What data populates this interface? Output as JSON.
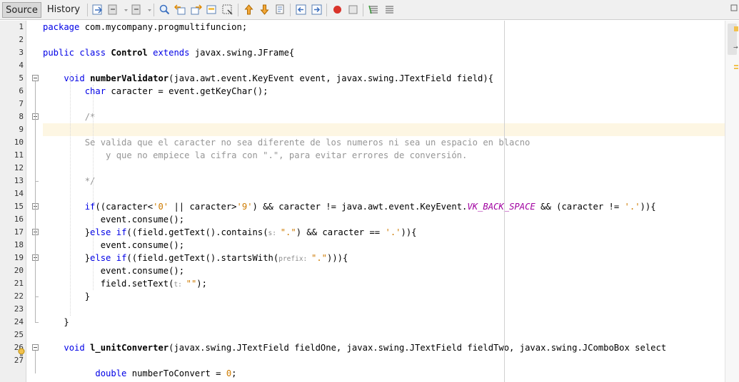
{
  "toolbar": {
    "tabs": {
      "source": "Source",
      "history": "History"
    }
  },
  "editor": {
    "line_numbers": [
      "1",
      "2",
      "3",
      "4",
      "5",
      "6",
      "7",
      "8",
      "9",
      "10",
      "11",
      "12",
      "13",
      "14",
      "15",
      "16",
      "17",
      "18",
      "19",
      "20",
      "21",
      "22",
      "23",
      "24",
      "25",
      "26",
      "27",
      ""
    ],
    "lines": [
      [
        {
          "t": "package",
          "c": "kw"
        },
        {
          "t": " com.mycompany.progmultifuncion;"
        }
      ],
      [],
      [
        {
          "t": "public class",
          "c": "kw"
        },
        {
          "t": " "
        },
        {
          "t": "Control",
          "c": "b"
        },
        {
          "t": " "
        },
        {
          "t": "extends",
          "c": "kw"
        },
        {
          "t": " javax.swing.JFrame{"
        }
      ],
      [],
      [
        {
          "t": "    "
        },
        {
          "t": "void",
          "c": "kw"
        },
        {
          "t": " "
        },
        {
          "t": "numberValidator",
          "c": "b"
        },
        {
          "t": "(java.awt.event.KeyEvent event, javax.swing.JTextField field){"
        }
      ],
      [
        {
          "t": "        "
        },
        {
          "t": "char",
          "c": "kw"
        },
        {
          "t": " caracter = event.getKeyChar();"
        }
      ],
      [],
      [
        {
          "t": "        /*",
          "c": "cm"
        }
      ],
      [],
      [
        {
          "t": "        Se valida que el caracter no sea diferente de los numeros ni sea un espacio en blacno",
          "c": "cm"
        }
      ],
      [
        {
          "t": "            y que no empiece la cifra con \".\", para evitar errores de conversión.",
          "c": "cm"
        }
      ],
      [],
      [
        {
          "t": "        */",
          "c": "cm"
        }
      ],
      [],
      [
        {
          "t": "        "
        },
        {
          "t": "if",
          "c": "kw"
        },
        {
          "t": "((caracter<"
        },
        {
          "t": "'0'",
          "c": "str"
        },
        {
          "t": " || caracter>"
        },
        {
          "t": "'9'",
          "c": "str"
        },
        {
          "t": ") && caracter != java.awt.event.KeyEvent."
        },
        {
          "t": "VK_BACK_SPACE",
          "c": "fld"
        },
        {
          "t": " && (caracter != "
        },
        {
          "t": "'.'",
          "c": "str"
        },
        {
          "t": ")){"
        }
      ],
      [
        {
          "t": "           event.consume();"
        }
      ],
      [
        {
          "t": "        }"
        },
        {
          "t": "else if",
          "c": "kw"
        },
        {
          "t": "((field.getText().contains("
        },
        {
          "t": "s: ",
          "c": "hint"
        },
        {
          "t": "\".\"",
          "c": "str"
        },
        {
          "t": ") && caracter == "
        },
        {
          "t": "'.'",
          "c": "str"
        },
        {
          "t": ")){"
        }
      ],
      [
        {
          "t": "           event.consume();"
        }
      ],
      [
        {
          "t": "        }"
        },
        {
          "t": "else if",
          "c": "kw"
        },
        {
          "t": "((field.getText().startsWith("
        },
        {
          "t": "prefix: ",
          "c": "hint"
        },
        {
          "t": "\".\"",
          "c": "str"
        },
        {
          "t": "))){"
        }
      ],
      [
        {
          "t": "           event.consume();"
        }
      ],
      [
        {
          "t": "           field.setText("
        },
        {
          "t": "t: ",
          "c": "hint"
        },
        {
          "t": "\"\"",
          "c": "str"
        },
        {
          "t": ");"
        }
      ],
      [
        {
          "t": "        }"
        }
      ],
      [],
      [
        {
          "t": "    }"
        }
      ],
      [],
      [
        {
          "t": "    "
        },
        {
          "t": "void",
          "c": "kw"
        },
        {
          "t": " "
        },
        {
          "t": "l_unitConverter",
          "c": "b"
        },
        {
          "t": "(javax.swing.JTextField fieldOne, javax.swing.JTextField fieldTwo, javax.swing.JComboBox select"
        }
      ],
      [],
      [
        {
          "t": "          "
        },
        {
          "t": "double",
          "c": "kw"
        },
        {
          "t": " numberToConvert = "
        },
        {
          "t": "0",
          "c": "str"
        },
        {
          "t": ";"
        }
      ]
    ],
    "highlighted_line": 9
  },
  "colors": {
    "keyword": "#0000e6",
    "comment": "#969696",
    "string": "#ce7b00",
    "static_field": "#a000a0",
    "current_line": "#fdf6e3"
  }
}
